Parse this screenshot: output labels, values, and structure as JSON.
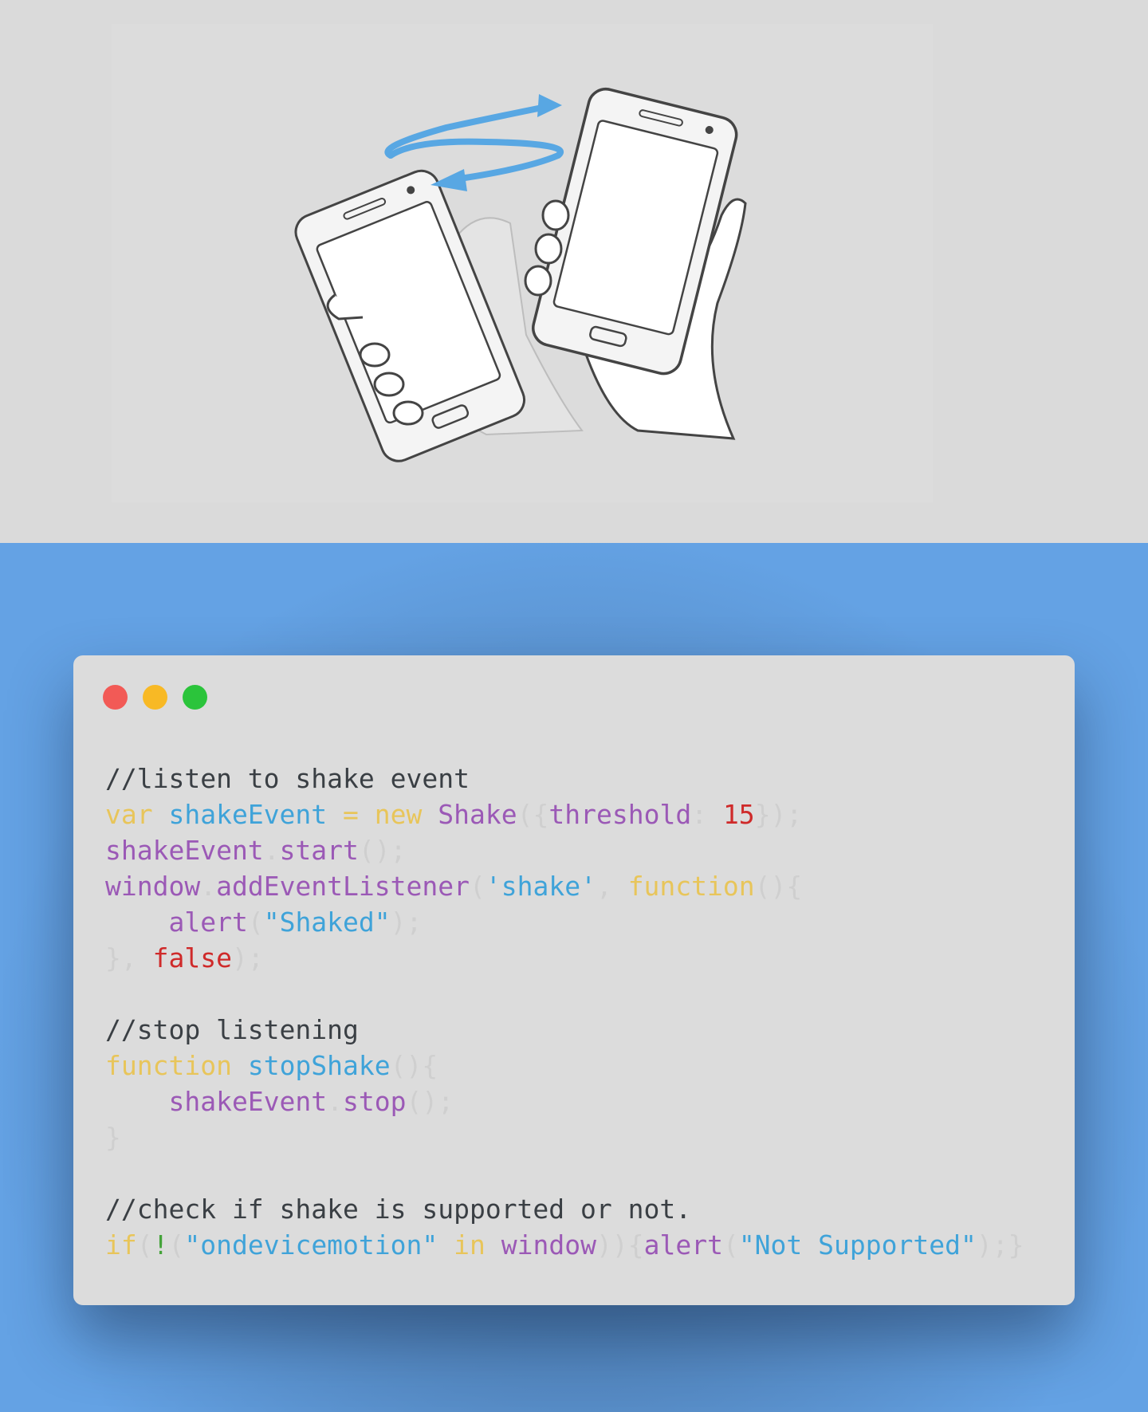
{
  "colors": {
    "hero_bg": "#dadada",
    "stage_bg": "#64a2e4",
    "window_bg": "#dcdcdc",
    "dot_red": "#f25a56",
    "dot_yellow": "#f8b925",
    "dot_green": "#2bc43b",
    "comment": "#3a3f44",
    "keyword": "#e8c55a",
    "identifier": "#9b59b6",
    "name": "#3fa3d9",
    "string": "#3fa3d9",
    "number": "#cf2a2a",
    "punct": "#cfcfcf"
  },
  "illustration": {
    "icon": "shake-phone-icon"
  },
  "code_lines": [
    [
      {
        "t": "//listen to shake event",
        "c": "comment"
      }
    ],
    [
      {
        "t": "var",
        "c": "keyword"
      },
      {
        "t": " ",
        "c": "punct"
      },
      {
        "t": "shakeEvent",
        "c": "name"
      },
      {
        "t": " ",
        "c": "punct"
      },
      {
        "t": "=",
        "c": "keyword"
      },
      {
        "t": " ",
        "c": "punct"
      },
      {
        "t": "new",
        "c": "keyword"
      },
      {
        "t": " ",
        "c": "punct"
      },
      {
        "t": "Shake",
        "c": "identifier"
      },
      {
        "t": "({",
        "c": "punct"
      },
      {
        "t": "threshold",
        "c": "identifier"
      },
      {
        "t": ": ",
        "c": "punct"
      },
      {
        "t": "15",
        "c": "number"
      },
      {
        "t": "});",
        "c": "punct"
      }
    ],
    [
      {
        "t": "shakeEvent",
        "c": "identifier"
      },
      {
        "t": ".",
        "c": "punct"
      },
      {
        "t": "start",
        "c": "identifier"
      },
      {
        "t": "();",
        "c": "punct"
      }
    ],
    [
      {
        "t": "window",
        "c": "identifier"
      },
      {
        "t": ".",
        "c": "punct"
      },
      {
        "t": "addEventListener",
        "c": "identifier"
      },
      {
        "t": "(",
        "c": "punct"
      },
      {
        "t": "'shake'",
        "c": "string"
      },
      {
        "t": ", ",
        "c": "punct"
      },
      {
        "t": "function",
        "c": "keyword"
      },
      {
        "t": "(){",
        "c": "punct"
      }
    ],
    [
      {
        "t": "    ",
        "c": "punct"
      },
      {
        "t": "alert",
        "c": "identifier"
      },
      {
        "t": "(",
        "c": "punct"
      },
      {
        "t": "\"Shaked\"",
        "c": "string"
      },
      {
        "t": ");",
        "c": "punct"
      }
    ],
    [
      {
        "t": "}, ",
        "c": "punct"
      },
      {
        "t": "false",
        "c": "number"
      },
      {
        "t": ");",
        "c": "punct"
      }
    ],
    [],
    [
      {
        "t": "//stop listening",
        "c": "comment"
      }
    ],
    [
      {
        "t": "function",
        "c": "keyword"
      },
      {
        "t": " ",
        "c": "punct"
      },
      {
        "t": "stopShake",
        "c": "name"
      },
      {
        "t": "(){",
        "c": "punct"
      }
    ],
    [
      {
        "t": "    ",
        "c": "punct"
      },
      {
        "t": "shakeEvent",
        "c": "identifier"
      },
      {
        "t": ".",
        "c": "punct"
      },
      {
        "t": "stop",
        "c": "identifier"
      },
      {
        "t": "();",
        "c": "punct"
      }
    ],
    [
      {
        "t": "}",
        "c": "punct"
      }
    ],
    [],
    [
      {
        "t": "//check if shake is supported or not.",
        "c": "comment"
      }
    ],
    [
      {
        "t": "if",
        "c": "keyword"
      },
      {
        "t": "(",
        "c": "punct"
      },
      {
        "t": "!",
        "c": "comment_green"
      },
      {
        "t": "(",
        "c": "punct"
      },
      {
        "t": "\"ondevicemotion\"",
        "c": "string"
      },
      {
        "t": " ",
        "c": "punct"
      },
      {
        "t": "in",
        "c": "keyword"
      },
      {
        "t": " ",
        "c": "punct"
      },
      {
        "t": "window",
        "c": "identifier"
      },
      {
        "t": ")){",
        "c": "punct"
      },
      {
        "t": "alert",
        "c": "identifier"
      },
      {
        "t": "(",
        "c": "punct"
      },
      {
        "t": "\"Not Supported\"",
        "c": "string"
      },
      {
        "t": ");}",
        "c": "punct"
      }
    ]
  ]
}
